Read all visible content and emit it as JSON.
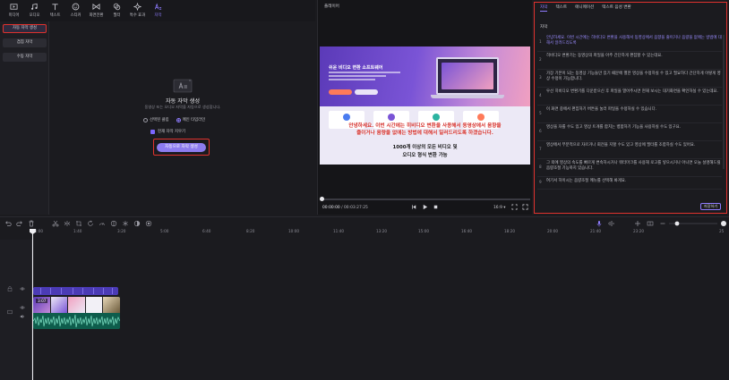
{
  "toolbar": {
    "items": [
      {
        "label": "미디어",
        "icon": "media-icon"
      },
      {
        "label": "오디오",
        "icon": "audio-icon"
      },
      {
        "label": "텍스트",
        "icon": "text-icon"
      },
      {
        "label": "스티커",
        "icon": "sticker-icon"
      },
      {
        "label": "화면전환",
        "icon": "transition-icon"
      },
      {
        "label": "필터",
        "icon": "filter-icon"
      },
      {
        "label": "특수 효과",
        "icon": "effects-icon"
      },
      {
        "label": "자막",
        "icon": "subtitle-icon"
      }
    ],
    "active_index": 7
  },
  "leftnav": {
    "items": [
      "자동 자막 생성",
      "겹침 자막",
      "수동 자막"
    ],
    "selected_index": 0
  },
  "gen": {
    "title": "자동 자막 생성",
    "subtitle": "동영상 또는 오디오 자막을 자동으로 생성합니다.",
    "radio_1": "선택된 클립",
    "radio_2": "메인 타임라인",
    "radio_selected": 2,
    "checkbox_label": "현재 자막 지우기",
    "button": "자동으로 자막 생성",
    "remaining_prefix": "남은 시간: 107 분",
    "remaining_link": "시간 구매하기"
  },
  "player": {
    "title": "플레이어",
    "video_headline": "쉬운 비디오 변환 소프트웨어",
    "subtitle_text_1": "안녕하세요. 이번 시간에는 히비디오 변환을 사용해서 동영상에서 음향을",
    "subtitle_text_2": "줄이거나 음량을 없애는 방법에 대해서 일러드리도록 하겠습니다.",
    "bottom_text_1": "1000개 이상의 모든 비디오 및",
    "bottom_text_2": "오디오 형식 변환 가능",
    "time_current": "00:00:00",
    "time_total": "00:03:27:25",
    "aspect_ratio": "16:9"
  },
  "rpanel": {
    "tabs": [
      "자막",
      "텍스트",
      "애니메이션",
      "텍스트 음성 변환"
    ],
    "active_tab": 0,
    "header": "자막",
    "items": [
      {
        "num": "1",
        "text": "안녕하세요. 이번 시간에는 히비디오 변환을 사용해서 동영상에서 음향을 줄이거나 음량을 없애는 방법에 대해서 알려드리도록"
      },
      {
        "num": "2",
        "text": "히비디오 변환기는 동영상의 파일을 아주 간단하게 편집할 수 있는데요."
      },
      {
        "num": "3",
        "text": "가장 기본이 되는 동영상 기능들만 있기 때문에 별한 영상을 수정하실 수 있고 필요하다 간단하게 이렇게 영상 수정이 가능합니다."
      },
      {
        "num": "4",
        "text": "우선 히비디오 변환기를 다운받으신 후 파일을 열어주시면 현재 보시는 대기화면을 확인하실 수 있는데요."
      },
      {
        "num": "5",
        "text": "이 화면 중에서 편집하기 버튼을 눌러 파일을 수정하실 수 있습니다."
      },
      {
        "num": "6",
        "text": "영상을 자를 수도 있고 영상 트개를 합치는 병합하기 기능을 사용하실 수도 있구요."
      },
      {
        "num": "7",
        "text": "영상에서 부분적으로 자르거나 회전을 지할 수도 있고 영상에 필터를 조합하실 수도 있어요."
      },
      {
        "num": "8",
        "text": "그 외에 영상의 속도를 빠르게 변속하시거나 워터마크를 사용해 로고를 넣으시거나 아니면 오늘 설명해드릴 음량조절 기능까지 있습니다."
      },
      {
        "num": "9",
        "text": "여기서 하이시는 음량조절 메뉴를 선택해 봐게요."
      }
    ],
    "selected_item": 0,
    "save_button": "저장하기"
  },
  "timeline": {
    "ticks": [
      "00:00",
      "1:40",
      "3:20",
      "5:00",
      "6:40",
      "8:20",
      "10:00",
      "11:40",
      "13:20",
      "15:00",
      "16:40",
      "18:20",
      "20:00",
      "21:40",
      "23:20",
      "25"
    ],
    "clip_duration": "3:07"
  }
}
